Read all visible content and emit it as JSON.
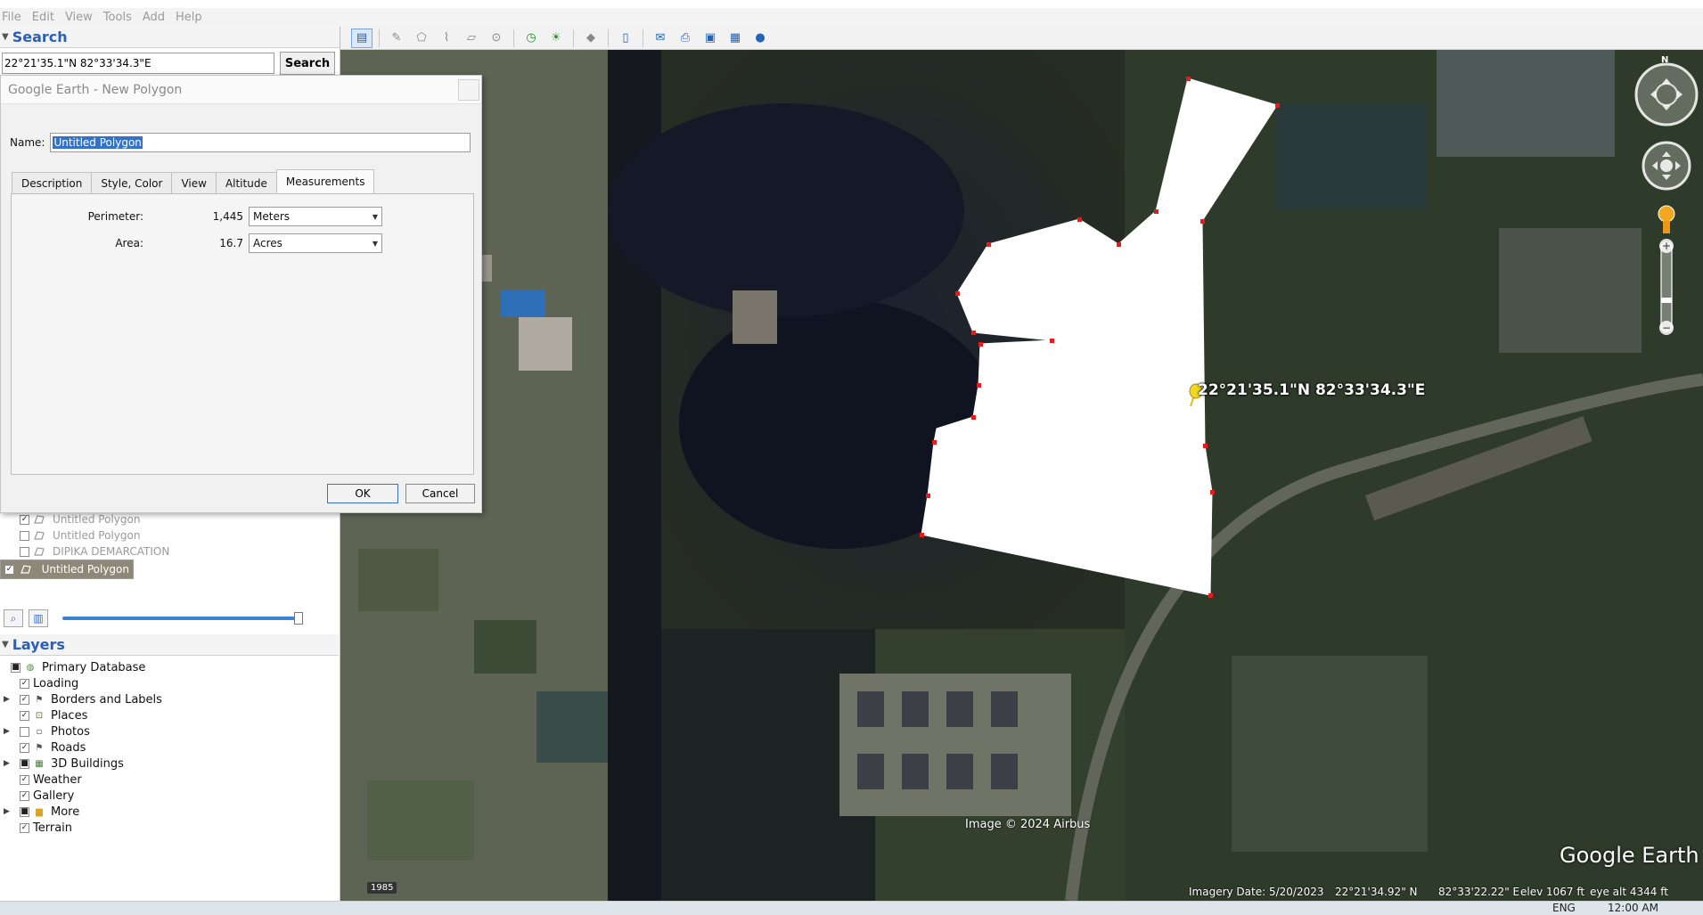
{
  "menu": [
    "File",
    "Edit",
    "View",
    "Tools",
    "Add",
    "Help"
  ],
  "search": {
    "header": "Search",
    "query": "22°21'35.1\"N 82°33'34.3\"E",
    "button": "Search"
  },
  "dialog": {
    "title": "Google Earth - New Polygon",
    "name_label": "Name:",
    "name_value": "Untitled Polygon",
    "tabs": [
      "Description",
      "Style, Color",
      "View",
      "Altitude",
      "Measurements"
    ],
    "active_tab": "Measurements",
    "perimeter_label": "Perimeter:",
    "perimeter_value": "1,445",
    "perimeter_unit": "Meters",
    "area_label": "Area:",
    "area_value": "16.7",
    "area_unit": "Acres",
    "ok": "OK",
    "cancel": "Cancel"
  },
  "places": [
    {
      "label": "Untitled Polygon",
      "checked": true
    },
    {
      "label": "Untitled Polygon",
      "checked": false
    },
    {
      "label": "DIPIKA DEMARCATION",
      "checked": false
    },
    {
      "label": "Untitled Polygon",
      "checked": true
    }
  ],
  "layers": {
    "header": "Layers",
    "items": [
      {
        "label": "Primary Database",
        "icon": "database-icon"
      },
      {
        "label": "Loading",
        "icon": "none"
      },
      {
        "label": "Borders and Labels",
        "icon": "border-flag-icon"
      },
      {
        "label": "Places",
        "icon": "places-icon"
      },
      {
        "label": "Photos",
        "icon": "photos-icon"
      },
      {
        "label": "Roads",
        "icon": "roads-icon"
      },
      {
        "label": "3D Buildings",
        "icon": "buildings-icon"
      },
      {
        "label": "Weather",
        "icon": "none"
      },
      {
        "label": "Gallery",
        "icon": "none"
      },
      {
        "label": "More",
        "icon": "folder-icon"
      },
      {
        "label": "Terrain",
        "icon": "none"
      }
    ]
  },
  "map": {
    "pin_label": "22°21'35.1\"N 82°33'34.3\"E",
    "copyright": "Image © 2024 Airbus",
    "logo": "Google Earth",
    "year": "1985",
    "imagery_date": "Imagery Date: 5/20/2023",
    "lat": "22°21'34.92\" N",
    "lon": "82°33'22.22\" E",
    "elev": "elev  1067 ft",
    "eye_alt": "eye alt   4344 ft",
    "compass_n": "N"
  },
  "taskbar": {
    "lang": "ENG",
    "time": "12:00 AM"
  },
  "colors": {
    "accent": "#2a5fb5",
    "polygon_fill": "#ffffff",
    "vertex": "#e01e1e",
    "selection": "#8d8878"
  }
}
